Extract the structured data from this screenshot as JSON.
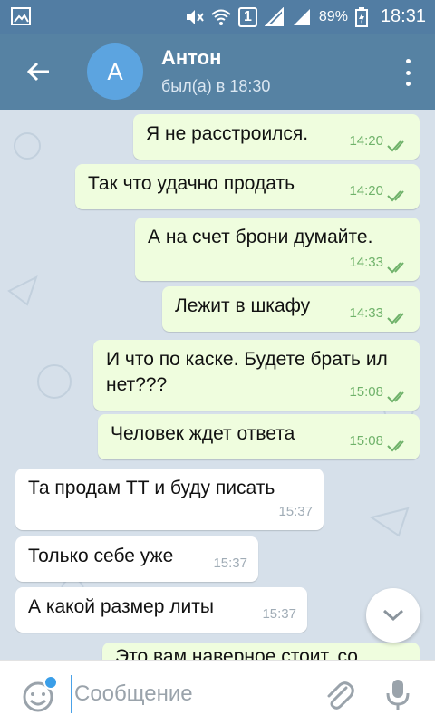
{
  "status_bar": {
    "battery": "89%",
    "time": "18:31",
    "sim_label": "1"
  },
  "header": {
    "avatar_letter": "А",
    "contact_name": "Антон",
    "last_seen": "был(а) в 18:30"
  },
  "messages": [
    {
      "dir": "out",
      "text": "Я не расстроился.",
      "time": "14:20"
    },
    {
      "dir": "out",
      "text": "Так что удачно продать",
      "time": "14:20"
    },
    {
      "dir": "out",
      "text": "А на счет брони думайте.",
      "time": "14:33"
    },
    {
      "dir": "out",
      "text": "Лежит в шкафу",
      "time": "14:33"
    },
    {
      "dir": "out",
      "text": "И что по каске. Будете брать ил нет???",
      "time": "15:08"
    },
    {
      "dir": "out",
      "text": "Человек ждет ответа",
      "time": "15:08"
    },
    {
      "dir": "in",
      "text": "Та продам ТТ и буду писать",
      "time": "15:37"
    },
    {
      "dir": "in",
      "text": "Только себе уже",
      "time": "15:37"
    },
    {
      "dir": "in",
      "text": "А какой размер литы",
      "time": "15:37"
    },
    {
      "dir": "out",
      "text": "Это вам наверное стоит, со",
      "time": ""
    }
  ],
  "composer": {
    "placeholder": "Сообщение",
    "value": ""
  },
  "colors": {
    "header": "#5682a3",
    "status_bar": "#527da3",
    "outgoing_bubble": "#effdde",
    "incoming_bubble": "#ffffff",
    "check_color": "#6fb26a"
  },
  "icons": [
    "back-arrow-icon",
    "more-vert-icon",
    "double-check-icon",
    "chevron-down-icon",
    "emoji-icon",
    "paperclip-icon",
    "microphone-icon"
  ]
}
